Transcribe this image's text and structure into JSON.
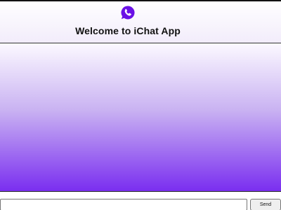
{
  "header": {
    "title": "Welcome to iChat App",
    "logo_icon": "whatsapp-chat-bubble-phone-icon",
    "logo_color": "#6a11e6"
  },
  "chat": {
    "messages": [],
    "gradient_top": "#fbf8ff",
    "gradient_bottom": "#7a2ef0"
  },
  "composer": {
    "value": "",
    "placeholder": "",
    "send_label": "Send"
  }
}
